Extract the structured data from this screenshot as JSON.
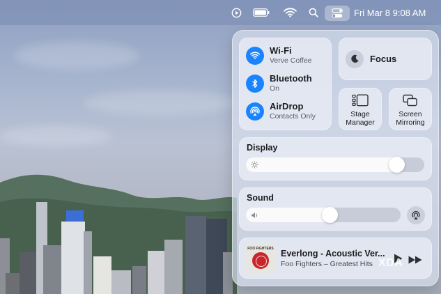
{
  "menubar": {
    "icons": [
      "play-circle-icon",
      "battery-icon",
      "wifi-icon",
      "search-icon",
      "control-center-icon"
    ],
    "datetime": "Fri Mar 8  9:08 AM"
  },
  "control_center": {
    "connectivity": [
      {
        "title": "Wi-Fi",
        "subtitle": "Verve Coffee",
        "icon": "wifi-icon",
        "active": true
      },
      {
        "title": "Bluetooth",
        "subtitle": "On",
        "icon": "bluetooth-icon",
        "active": true
      },
      {
        "title": "AirDrop",
        "subtitle": "Contacts Only",
        "icon": "airdrop-icon",
        "active": true
      }
    ],
    "focus": {
      "label": "Focus",
      "icon": "moon-icon"
    },
    "stage_manager": {
      "label_line1": "Stage",
      "label_line2": "Manager",
      "icon": "stage-manager-icon"
    },
    "screen_mirroring": {
      "label_line1": "Screen",
      "label_line2": "Mirroring",
      "icon": "screen-mirroring-icon"
    },
    "display": {
      "label": "Display",
      "level": 0.88,
      "icon": "brightness-icon"
    },
    "sound": {
      "label": "Sound",
      "level": 0.55,
      "icon": "speaker-icon",
      "output_icon": "airplay-audio-icon"
    },
    "now_playing": {
      "title": "Everlong - Acoustic Ver...",
      "artist": "Foo Fighters – Greatest Hits",
      "album_art_text": "FOO FIGHTERS",
      "controls": [
        "play-icon",
        "fast-forward-icon"
      ]
    }
  },
  "watermark": "XDA",
  "colors": {
    "accent": "#1a84ff",
    "menubar": "#7e8fbb"
  }
}
